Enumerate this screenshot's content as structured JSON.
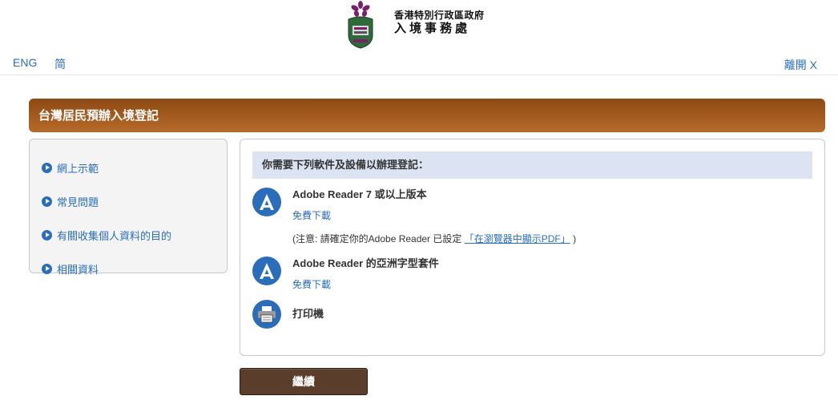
{
  "header": {
    "org_line1": "香港特別行政區政府",
    "org_line2": "入境事務處",
    "lang_eng": "ENG",
    "lang_sc": "简",
    "leave_label": "離開 X"
  },
  "page_title": "台灣居民預辦入境登記",
  "sidebar": {
    "items": [
      {
        "label": "網上示範"
      },
      {
        "label": "常見問題"
      },
      {
        "label": "有關收集個人資料的目的"
      },
      {
        "label": "相關資料"
      }
    ]
  },
  "requirements": {
    "heading": "你需要下列軟件及設備以辦理登記：",
    "items": [
      {
        "name": "Adobe Reader 7 或以上版本",
        "link": "免費下載",
        "note_prefix": "(注意: 請確定你的Adobe Reader 已設定",
        "note_link": "「在瀏覽器中顯示PDF」",
        "note_suffix": ")"
      },
      {
        "name": "Adobe Reader 的亞洲字型套件",
        "link": "免費下載"
      },
      {
        "name": "打印機"
      }
    ]
  },
  "continue_label": "繼續",
  "colors": {
    "link": "#2a6ebb",
    "title_bar": "#a0581c",
    "panel_head": "#dce3f2",
    "button": "#5a3d2b"
  }
}
